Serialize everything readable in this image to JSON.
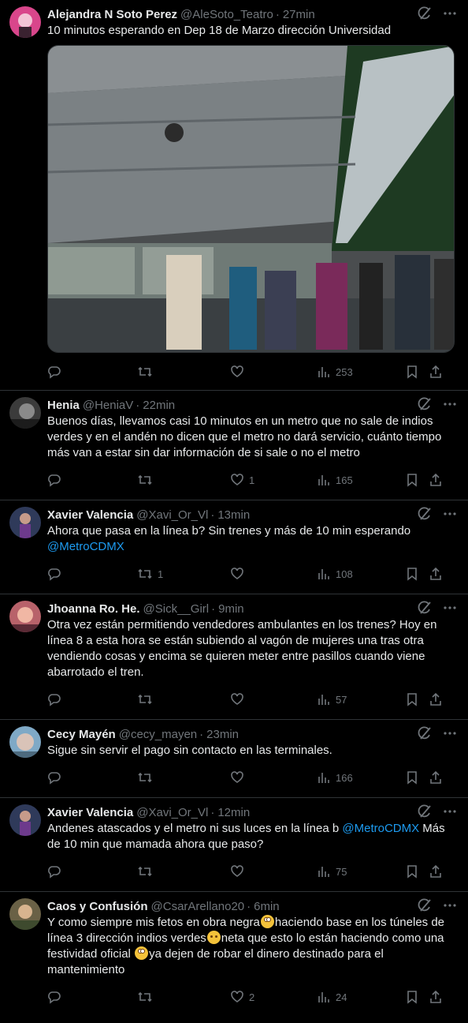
{
  "colors": {
    "background": "#000000",
    "text": "#e7e9ea",
    "muted": "#71767b",
    "link": "#1d9bf0",
    "divider": "#2f3336"
  },
  "icons": {
    "reply": "reply-icon",
    "retweet": "retweet-icon",
    "like": "heart-icon",
    "views": "bar-chart-icon",
    "bookmark": "bookmark-icon",
    "share": "share-icon",
    "grok": "grok-icon",
    "more": "more-icon"
  },
  "tweets": [
    {
      "name": "Alejandra N Soto Perez",
      "handle": "@AleSoto_Teatro",
      "time": "27min",
      "text": "10 minutos esperando en Dep 18 de Marzo dirección Universidad",
      "reply": "",
      "retweet": "",
      "like": "",
      "views": "253"
    },
    {
      "name": "Henia",
      "handle": "@HeniaV",
      "time": "22min",
      "text": "Buenos días, llevamos casi 10 minutos en un metro que no sale de indios verdes y en el andén no dicen que el metro no dará servicio, cuánto tiempo más van a estar sin dar información de si sale o no el metro",
      "reply": "",
      "retweet": "",
      "like": "1",
      "views": "165"
    },
    {
      "name": "Xavier Valencia",
      "handle": "@Xavi_Or_Vl",
      "time": "13min",
      "text": "Ahora que pasa en la línea b? Sin trenes y más de 10 min esperando",
      "mention": "@MetroCDMX",
      "reply": "",
      "retweet": "1",
      "like": "",
      "views": "108"
    },
    {
      "name": "Jhoanna Ro. He.",
      "handle": "@Sick__Girl",
      "time": "9min",
      "text": "Otra vez están permitiendo vendedores ambulantes en los trenes? Hoy en línea 8 a esta hora se están subiendo al vagón de mujeres una tras otra vendiendo cosas y encima se quieren meter entre pasillos cuando viene abarrotado el tren.",
      "reply": "",
      "retweet": "",
      "like": "",
      "views": "57"
    },
    {
      "name": "Cecy Mayén",
      "handle": "@cecy_mayen",
      "time": "23min",
      "text": "Sigue sin servir el pago sin contacto en las terminales.",
      "reply": "",
      "retweet": "",
      "like": "",
      "views": "166"
    },
    {
      "name": "Xavier Valencia",
      "handle": "@Xavi_Or_Vl",
      "time": "12min",
      "text_a": "Andenes atascados y el metro ni sus luces en la línea b ",
      "mention": "@MetroCDMX",
      "text_b": "  Más de 10 min que mamada ahora que paso?",
      "reply": "",
      "retweet": "",
      "like": "",
      "views": "75"
    },
    {
      "name": "Caos y Confusión",
      "handle": "@CsarArellano20",
      "time": "6min",
      "text_a": "Y como siempre mis fetos en obra negra",
      "text_b": "haciendo base en los túneles de línea 3 dirección indios verdes",
      "text_c": "neta que esto lo están haciendo como una festividad oficial ",
      "text_d": "ya dejen de robar el dinero destinado para el mantenimiento",
      "reply": "",
      "retweet": "",
      "like": "2",
      "views": "24"
    }
  ]
}
